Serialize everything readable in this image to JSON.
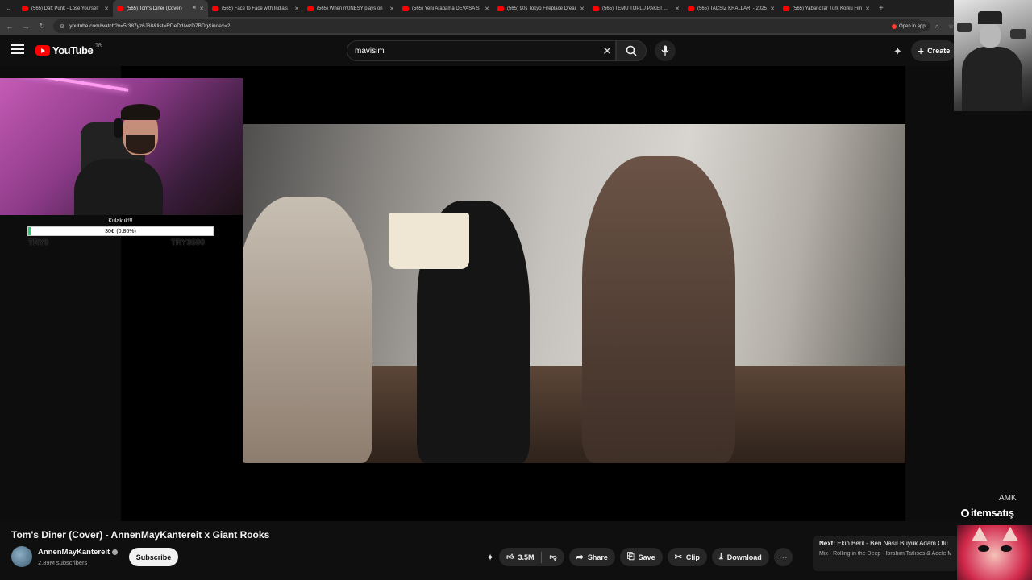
{
  "browser": {
    "tabs": [
      {
        "title": "(565) Daft Punk - Lose Yourself",
        "active": false
      },
      {
        "title": "(565) Tom's Diner (Cover)",
        "active": true
      },
      {
        "title": "(565) Face to Face with India's",
        "active": false
      },
      {
        "title": "(565) When m0NESY plays on",
        "active": false
      },
      {
        "title": "(565) Yeni Arabama DEVASA S",
        "active": false
      },
      {
        "title": "(565) 90s Tokyo Fireplace Dreai",
        "active": false
      },
      {
        "title": "(565) TEMU TOPLU PAKET AÇIL",
        "active": false
      },
      {
        "title": "(565) TAÇSIZ KRALLARI - 2025",
        "active": false
      },
      {
        "title": "(565) Yabancılar Türk Korku Filn",
        "active": false
      }
    ],
    "url": "youtube.com/watch?v=5r387yz6J68&list=RDeDd/wzD7BDg&index=2",
    "open_in_app": "Open in app"
  },
  "header": {
    "logo_text": "YouTube",
    "region": "TR",
    "search_value": "mavisim",
    "create_label": "Create"
  },
  "overlay": {
    "goal_title": "Kulaklık!!!",
    "goal_progress_text": "30₺ (0.86%)",
    "goal_progress": 0.0086,
    "goal_min": "TRY0",
    "goal_max": "TRY3500",
    "watermark_small": "AMK",
    "watermark_brand": "itemsatış"
  },
  "video": {
    "title": "Tom's Diner (Cover) - AnnenMayKantereit x Giant Rooks",
    "channel": "AnnenMayKantereit",
    "subscribers": "2.89M subscribers",
    "subscribe_label": "Subscribe",
    "likes": "3.5M",
    "share_label": "Share",
    "save_label": "Save",
    "clip_label": "Clip",
    "download_label": "Download"
  },
  "next": {
    "label": "Next:",
    "title": "Ekin Beril - Ben Nasıl Büyük Adam Olu",
    "subtitle": "Mix - Rolling in the Deep - İbrahim Tatlıses & Adele M"
  },
  "colors": {
    "accent": "#ff0000",
    "bg": "#0f0f0f",
    "goal_fill": "#1fd06a"
  }
}
